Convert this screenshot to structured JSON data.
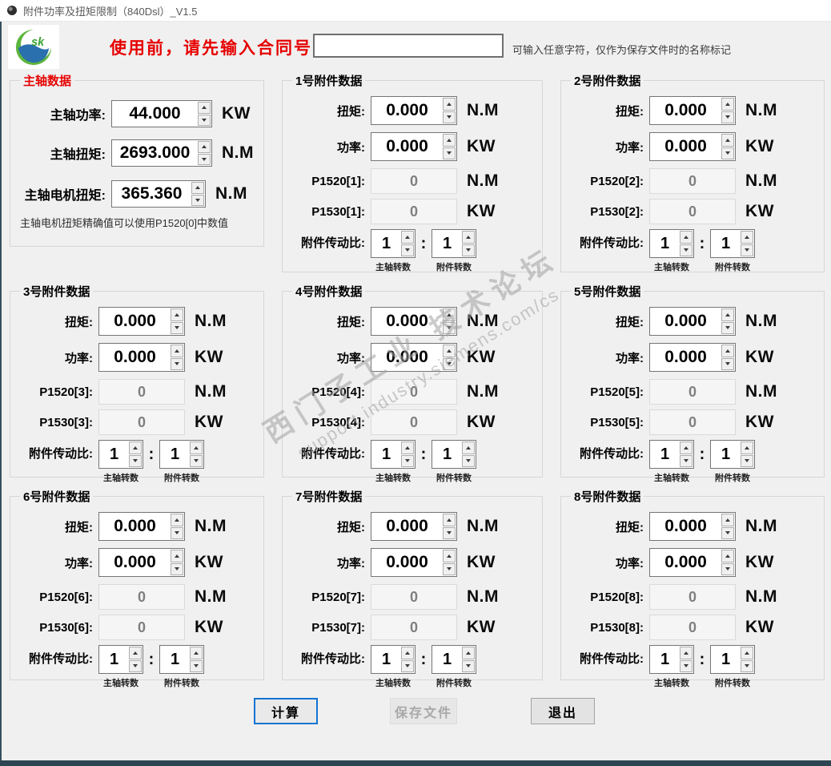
{
  "window": {
    "title": "附件功率及扭矩限制（840Dsl）_V1.5"
  },
  "header": {
    "logo_text": "sk",
    "prompt": "使用前，请先输入合同号:",
    "contract_input": {
      "value": "",
      "placeholder": ""
    },
    "note": "可输入任意字符，仅作为保存文件时的名称标记"
  },
  "spindle": {
    "title": "主轴数据",
    "power": {
      "label": "主轴功率:",
      "value": "44.000",
      "unit": "KW"
    },
    "torque": {
      "label": "主轴扭矩:",
      "value": "2693.000",
      "unit": "N.M"
    },
    "motor_torque": {
      "label": "主轴电机扭矩:",
      "value": "365.360",
      "unit": "N.M"
    },
    "note": "主轴电机扭矩精确值可以使用P1520[0]中数值"
  },
  "accessory_labels": {
    "torque": "扭矩:",
    "power": "功率:",
    "torque_unit": "N.M",
    "power_unit": "KW",
    "ratio": "附件传动比:",
    "colon": ":",
    "spindle_caption": "主轴转数",
    "accessory_caption": "附件转数"
  },
  "accessories": [
    {
      "title": "1号附件数据",
      "torque_value": "0.000",
      "power_value": "0.000",
      "p1520_label": "P1520[1]:",
      "p1520_value": "0",
      "p1530_label": "P1530[1]:",
      "p1530_value": "0",
      "ratio_spindle": "1",
      "ratio_accessory": "1"
    },
    {
      "title": "2号附件数据",
      "torque_value": "0.000",
      "power_value": "0.000",
      "p1520_label": "P1520[2]:",
      "p1520_value": "0",
      "p1530_label": "P1530[2]:",
      "p1530_value": "0",
      "ratio_spindle": "1",
      "ratio_accessory": "1"
    },
    {
      "title": "3号附件数据",
      "torque_value": "0.000",
      "power_value": "0.000",
      "p1520_label": "P1520[3]:",
      "p1520_value": "0",
      "p1530_label": "P1530[3]:",
      "p1530_value": "0",
      "ratio_spindle": "1",
      "ratio_accessory": "1"
    },
    {
      "title": "4号附件数据",
      "torque_value": "0.000",
      "power_value": "0.000",
      "p1520_label": "P1520[4]:",
      "p1520_value": "0",
      "p1530_label": "P1530[4]:",
      "p1530_value": "0",
      "ratio_spindle": "1",
      "ratio_accessory": "1"
    },
    {
      "title": "5号附件数据",
      "torque_value": "0.000",
      "power_value": "0.000",
      "p1520_label": "P1520[5]:",
      "p1520_value": "0",
      "p1530_label": "P1530[5]:",
      "p1530_value": "0",
      "ratio_spindle": "1",
      "ratio_accessory": "1"
    },
    {
      "title": "6号附件数据",
      "torque_value": "0.000",
      "power_value": "0.000",
      "p1520_label": "P1520[6]:",
      "p1520_value": "0",
      "p1530_label": "P1530[6]:",
      "p1530_value": "0",
      "ratio_spindle": "1",
      "ratio_accessory": "1"
    },
    {
      "title": "7号附件数据",
      "torque_value": "0.000",
      "power_value": "0.000",
      "p1520_label": "P1520[7]:",
      "p1520_value": "0",
      "p1530_label": "P1530[7]:",
      "p1530_value": "0",
      "ratio_spindle": "1",
      "ratio_accessory": "1"
    },
    {
      "title": "8号附件数据",
      "torque_value": "0.000",
      "power_value": "0.000",
      "p1520_label": "P1520[8]:",
      "p1520_value": "0",
      "p1530_label": "P1530[8]:",
      "p1530_value": "0",
      "ratio_spindle": "1",
      "ratio_accessory": "1"
    }
  ],
  "buttons": {
    "calculate": "计算",
    "save": "保存文件",
    "exit": "退出"
  },
  "watermark": {
    "line1": "西门子工业 技术论坛",
    "line2": "support.industry.siemens.com/cs"
  },
  "colors": {
    "accent_red": "#e60000",
    "focus_blue": "#1273d2",
    "frame_dark": "#35505c",
    "window_bg": "#f0f0f0",
    "disabled_text": "#7f7f7f",
    "logo_green": "#5cb53c",
    "logo_blue": "#2a6fae"
  }
}
